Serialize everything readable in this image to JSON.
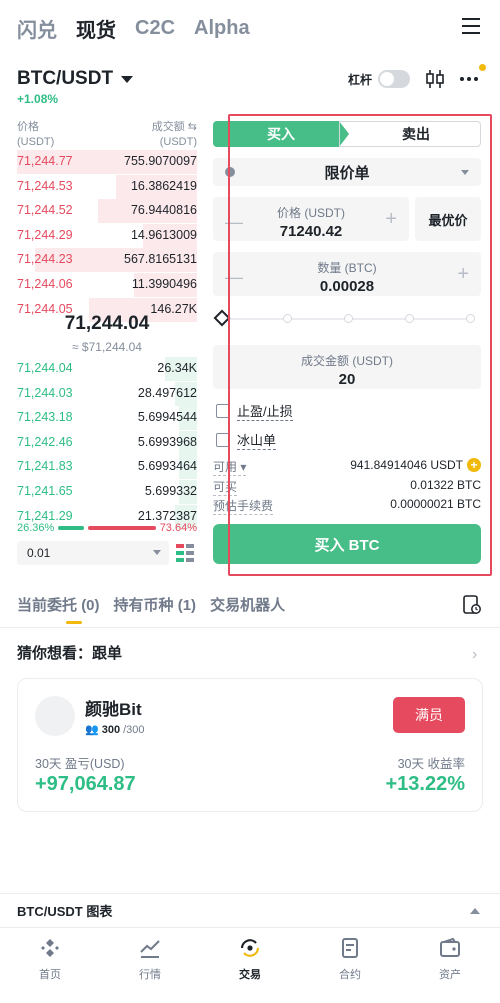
{
  "topnav": {
    "tabs": [
      "闪兑",
      "现货",
      "C2C",
      "Alpha"
    ],
    "active_index": 1
  },
  "pair": {
    "symbol": "BTC/USDT",
    "change": "+1.08%",
    "leverage_label": "杠杆"
  },
  "orderbook": {
    "price_header": "价格",
    "price_unit": "(USDT)",
    "amount_header": "成交额",
    "amount_unit": "(USDT)",
    "asks": [
      {
        "price": "71,244.77",
        "amount": "755.9070097",
        "depth": 1.0
      },
      {
        "price": "71,244.53",
        "amount": "16.3862419",
        "depth": 0.45
      },
      {
        "price": "71,244.52",
        "amount": "76.9440816",
        "depth": 0.55
      },
      {
        "price": "71,244.29",
        "amount": "14.9613009",
        "depth": 0.3
      },
      {
        "price": "71,244.23",
        "amount": "567.8165131",
        "depth": 0.9
      },
      {
        "price": "71,244.06",
        "amount": "11.3990496",
        "depth": 0.35
      },
      {
        "price": "71,244.05",
        "amount": "146.27K",
        "depth": 0.6
      }
    ],
    "mid_price": "71,244.04",
    "mid_price_usd": "≈ $71,244.04",
    "bids": [
      {
        "price": "71,244.04",
        "amount": "26.34K",
        "depth": 0.18
      },
      {
        "price": "71,244.03",
        "amount": "28.497612",
        "depth": 0.12
      },
      {
        "price": "71,243.18",
        "amount": "5.6994544",
        "depth": 0.1
      },
      {
        "price": "71,242.46",
        "amount": "5.6993968",
        "depth": 0.1
      },
      {
        "price": "71,241.83",
        "amount": "5.6993464",
        "depth": 0.1
      },
      {
        "price": "71,241.65",
        "amount": "5.699332",
        "depth": 0.1
      },
      {
        "price": "71,241.29",
        "amount": "21.372387",
        "depth": 0.12
      }
    ],
    "buy_ratio": "26.36%",
    "sell_ratio": "73.64%",
    "buy_ratio_value": 0.2636,
    "precision": "0.01"
  },
  "form": {
    "buy_tab": "买入",
    "sell_tab": "卖出",
    "order_type": "限价单",
    "price_label": "价格 (USDT)",
    "price_value": "71240.42",
    "best_price": "最优价",
    "qty_label": "数量 (BTC)",
    "qty_value": "0.00028",
    "total_label": "成交金额 (USDT)",
    "total_value": "20",
    "tp_sl": "止盈/止损",
    "iceberg": "冰山单",
    "available_label": "可用",
    "available_value": "941.84914046 USDT",
    "can_buy_label": "可买",
    "can_buy_value": "0.01322 BTC",
    "fee_label": "预估手续费",
    "fee_value": "0.00000021 BTC",
    "submit": "买入 BTC"
  },
  "orders_tabs": {
    "open": "当前委托",
    "open_count": "(0)",
    "holdings": "持有币种",
    "holdings_count": "(1)",
    "bots": "交易机器人"
  },
  "copy_trade": {
    "heading": "猜你想看：跟单",
    "trader": "颜驰Bit",
    "members_current": "300",
    "members_max": "/300",
    "full_button": "满员",
    "pnl_label": "30天 盈亏(USD)",
    "pnl_value": "+97,064.87",
    "roi_label": "30天 收益率",
    "roi_value": "+13.22%"
  },
  "chart_bar": "BTC/USDT 图表",
  "bottom_nav": [
    {
      "label": "首页",
      "icon": "home-icon"
    },
    {
      "label": "行情",
      "icon": "markets-icon"
    },
    {
      "label": "交易",
      "icon": "trade-icon"
    },
    {
      "label": "合约",
      "icon": "futures-icon"
    },
    {
      "label": "资产",
      "icon": "wallet-icon"
    }
  ],
  "colors": {
    "buy": "#47bd88",
    "sell": "#e64a5e",
    "brand": "#f0b90b"
  }
}
